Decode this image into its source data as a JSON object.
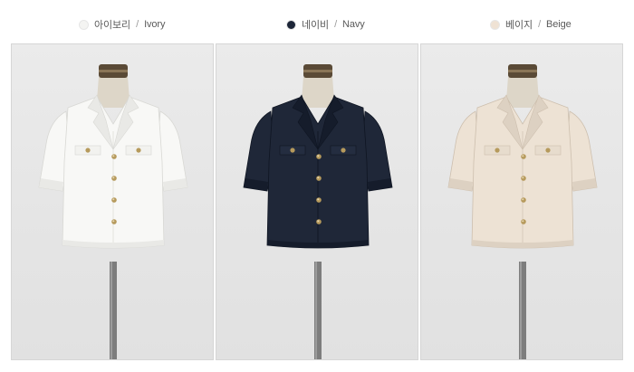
{
  "colors": [
    {
      "korean": "아이보리",
      "separator": "/",
      "english": "Ivory",
      "swatch_hex": "#f4f4f2",
      "shirt_hex": "#f8f8f6",
      "shade_hex": "#e9e9e6",
      "pocket_hex": "#f2f2ef"
    },
    {
      "korean": "네이비",
      "separator": "/",
      "english": "Navy",
      "swatch_hex": "#1d2638",
      "shirt_hex": "#1f2738",
      "shade_hex": "#151c2b",
      "pocket_hex": "#242d40"
    },
    {
      "korean": "베이지",
      "separator": "/",
      "english": "Beige",
      "swatch_hex": "#efe2d4",
      "shirt_hex": "#ede2d4",
      "shade_hex": "#ddd1c2",
      "pocket_hex": "#e7dccd"
    }
  ],
  "mannequin": {
    "skin_hex": "#ddd6c8",
    "neck_band_hex": "#5a4a36",
    "pole_hex": "#7d7d7d",
    "button_hex": "#b69a5c"
  }
}
